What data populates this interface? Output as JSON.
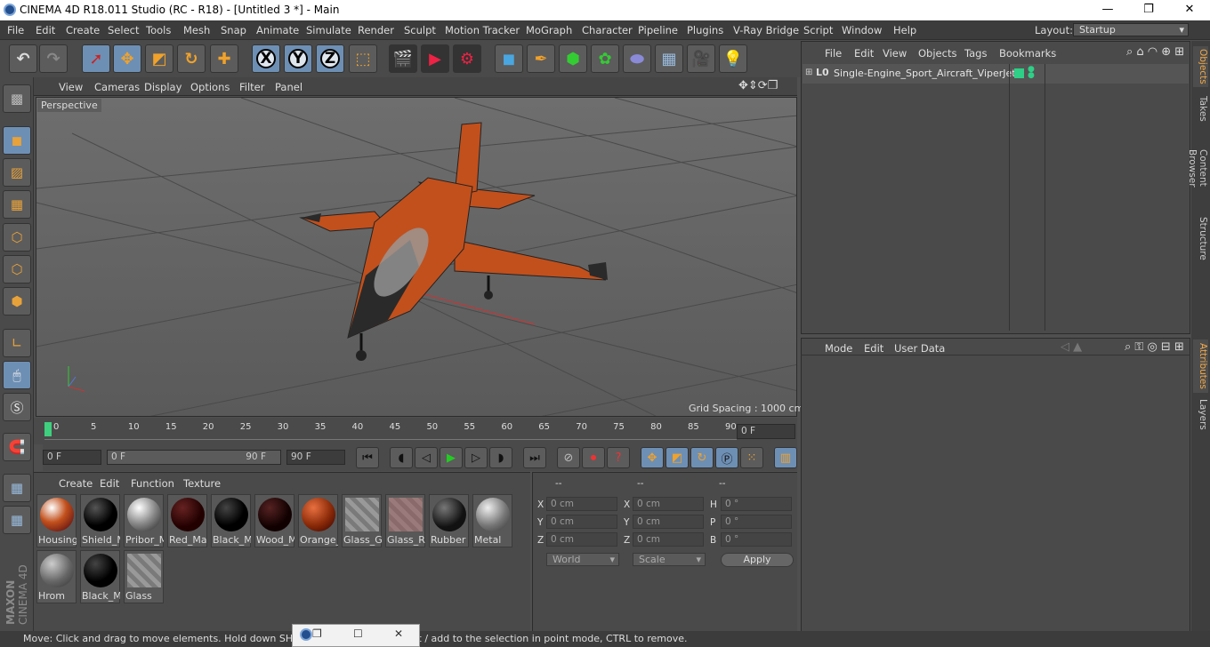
{
  "window": {
    "title": "CINEMA 4D R18.011 Studio (RC - R18) - [Untitled 3 *] - Main"
  },
  "menu": [
    "File",
    "Edit",
    "Create",
    "Select",
    "Tools",
    "Mesh",
    "Snap",
    "Animate",
    "Simulate",
    "Render",
    "Sculpt",
    "Motion Tracker",
    "MoGraph",
    "Character",
    "Pipeline",
    "Plugins",
    "V-Ray Bridge",
    "Script",
    "Window",
    "Help"
  ],
  "layout": {
    "label": "Layout:",
    "value": "Startup"
  },
  "toolbar": {
    "axis_x": "X",
    "axis_y": "Y",
    "axis_z": "Z"
  },
  "viewport": {
    "menu": [
      "View",
      "Cameras",
      "Display",
      "Options",
      "Filter",
      "Panel"
    ],
    "label": "Perspective",
    "grid_info": "Grid Spacing : 1000 cm"
  },
  "timeline": {
    "ticks": [
      "0",
      "5",
      "10",
      "15",
      "20",
      "25",
      "30",
      "35",
      "40",
      "45",
      "50",
      "55",
      "60",
      "65",
      "70",
      "75",
      "80",
      "85",
      "90"
    ],
    "current_frame": "0 F",
    "start": "0 F",
    "range_start": "0 F",
    "range_end": "90 F",
    "end": "90 F"
  },
  "materials": {
    "menu": [
      "Create",
      "Edit",
      "Function",
      "Texture"
    ],
    "items": [
      "Housing",
      "Shield_M",
      "Pribor_M",
      "Red_Ma",
      "Black_M",
      "Wood_M",
      "Orange_",
      "Glass_G",
      "Glass_Re",
      "Rubber",
      "Metal",
      "Hrom",
      "Black_M",
      "Glass"
    ]
  },
  "coords": {
    "headers": [
      "--",
      "--",
      "--"
    ],
    "rows": [
      {
        "a": "X",
        "av": "0 cm",
        "b": "X",
        "bv": "0 cm",
        "c": "H",
        "cv": "0 °"
      },
      {
        "a": "Y",
        "av": "0 cm",
        "b": "Y",
        "bv": "0 cm",
        "c": "P",
        "cv": "0 °"
      },
      {
        "a": "Z",
        "av": "0 cm",
        "b": "Z",
        "bv": "0 cm",
        "c": "B",
        "cv": "0 °"
      }
    ],
    "world": "World",
    "scale": "Scale",
    "apply": "Apply"
  },
  "objects": {
    "menu": [
      "File",
      "Edit",
      "View",
      "Objects",
      "Tags",
      "Bookmarks"
    ],
    "item": "Single-Engine_Sport_Aircraft_ViperJet",
    "layer_tag": "L0"
  },
  "attributes": {
    "menu": [
      "Mode",
      "Edit",
      "User Data"
    ]
  },
  "side_tabs": [
    "Objects",
    "Takes",
    "Content Browser",
    "Structure",
    "Attributes",
    "Layers"
  ],
  "status": "Move: Click and drag to move elements. Hold down SHIFT to quantize movement / add to the selection in point mode, CTRL to remove.",
  "brand": {
    "line1": "MAXON",
    "line2": "CINEMA 4D"
  },
  "colors": {
    "accent": "#6e8fb4",
    "aircraft_orange": "#c2501c",
    "tab_active": "#f0a84a"
  }
}
